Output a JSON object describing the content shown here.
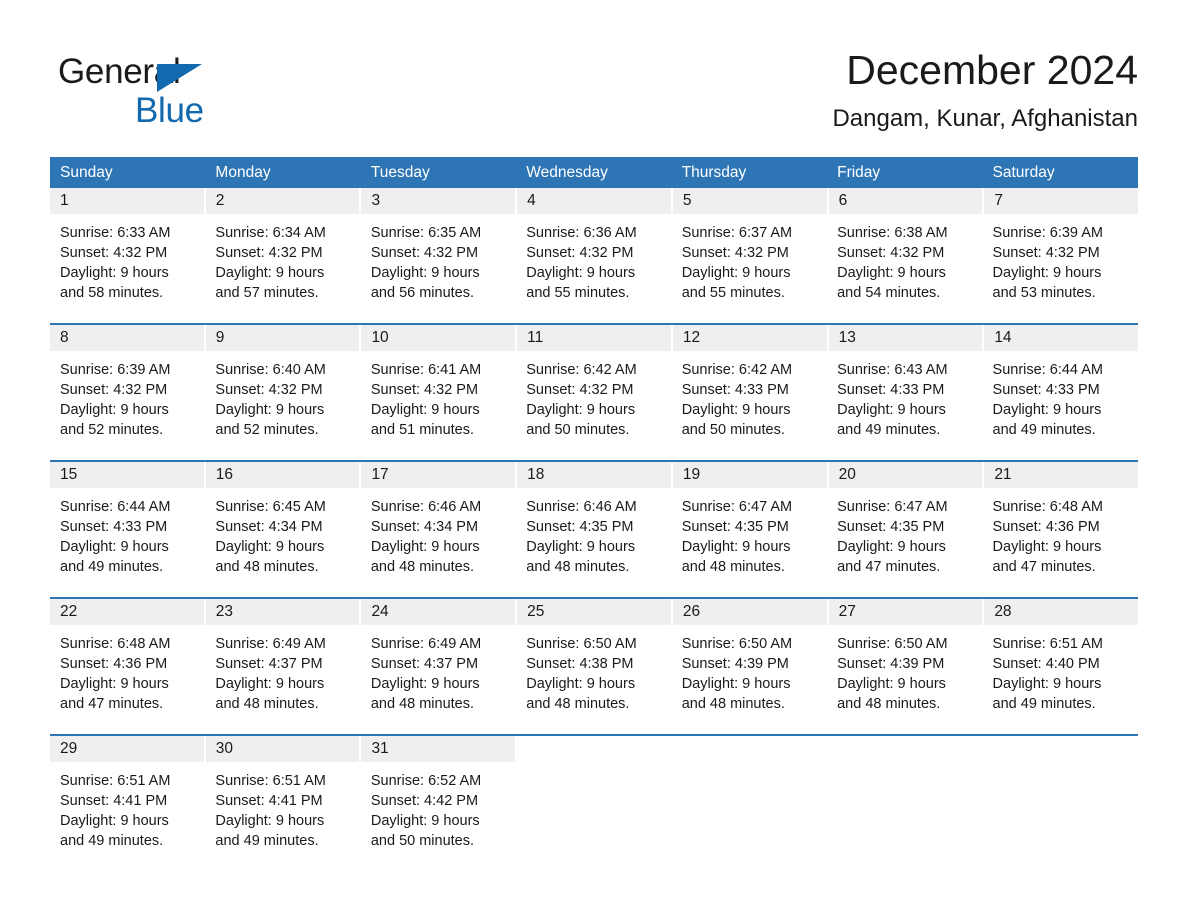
{
  "brand": {
    "name_part1": "General",
    "name_part2": "Blue",
    "accent_color": "#1369ad"
  },
  "header": {
    "title": "December 2024",
    "subtitle": "Dangam, Kunar, Afghanistan"
  },
  "theme": {
    "header_blue": "#2e75b6",
    "daynum_gray": "#efefef",
    "text_color": "#1a1a1a"
  },
  "weekdays": [
    "Sunday",
    "Monday",
    "Tuesday",
    "Wednesday",
    "Thursday",
    "Friday",
    "Saturday"
  ],
  "weeks": [
    {
      "days": [
        {
          "num": "1",
          "sunrise": "Sunrise: 6:33 AM",
          "sunset": "Sunset: 4:32 PM",
          "daylight_line1": "Daylight: 9 hours",
          "daylight_line2": "and 58 minutes."
        },
        {
          "num": "2",
          "sunrise": "Sunrise: 6:34 AM",
          "sunset": "Sunset: 4:32 PM",
          "daylight_line1": "Daylight: 9 hours",
          "daylight_line2": "and 57 minutes."
        },
        {
          "num": "3",
          "sunrise": "Sunrise: 6:35 AM",
          "sunset": "Sunset: 4:32 PM",
          "daylight_line1": "Daylight: 9 hours",
          "daylight_line2": "and 56 minutes."
        },
        {
          "num": "4",
          "sunrise": "Sunrise: 6:36 AM",
          "sunset": "Sunset: 4:32 PM",
          "daylight_line1": "Daylight: 9 hours",
          "daylight_line2": "and 55 minutes."
        },
        {
          "num": "5",
          "sunrise": "Sunrise: 6:37 AM",
          "sunset": "Sunset: 4:32 PM",
          "daylight_line1": "Daylight: 9 hours",
          "daylight_line2": "and 55 minutes."
        },
        {
          "num": "6",
          "sunrise": "Sunrise: 6:38 AM",
          "sunset": "Sunset: 4:32 PM",
          "daylight_line1": "Daylight: 9 hours",
          "daylight_line2": "and 54 minutes."
        },
        {
          "num": "7",
          "sunrise": "Sunrise: 6:39 AM",
          "sunset": "Sunset: 4:32 PM",
          "daylight_line1": "Daylight: 9 hours",
          "daylight_line2": "and 53 minutes."
        }
      ]
    },
    {
      "days": [
        {
          "num": "8",
          "sunrise": "Sunrise: 6:39 AM",
          "sunset": "Sunset: 4:32 PM",
          "daylight_line1": "Daylight: 9 hours",
          "daylight_line2": "and 52 minutes."
        },
        {
          "num": "9",
          "sunrise": "Sunrise: 6:40 AM",
          "sunset": "Sunset: 4:32 PM",
          "daylight_line1": "Daylight: 9 hours",
          "daylight_line2": "and 52 minutes."
        },
        {
          "num": "10",
          "sunrise": "Sunrise: 6:41 AM",
          "sunset": "Sunset: 4:32 PM",
          "daylight_line1": "Daylight: 9 hours",
          "daylight_line2": "and 51 minutes."
        },
        {
          "num": "11",
          "sunrise": "Sunrise: 6:42 AM",
          "sunset": "Sunset: 4:32 PM",
          "daylight_line1": "Daylight: 9 hours",
          "daylight_line2": "and 50 minutes."
        },
        {
          "num": "12",
          "sunrise": "Sunrise: 6:42 AM",
          "sunset": "Sunset: 4:33 PM",
          "daylight_line1": "Daylight: 9 hours",
          "daylight_line2": "and 50 minutes."
        },
        {
          "num": "13",
          "sunrise": "Sunrise: 6:43 AM",
          "sunset": "Sunset: 4:33 PM",
          "daylight_line1": "Daylight: 9 hours",
          "daylight_line2": "and 49 minutes."
        },
        {
          "num": "14",
          "sunrise": "Sunrise: 6:44 AM",
          "sunset": "Sunset: 4:33 PM",
          "daylight_line1": "Daylight: 9 hours",
          "daylight_line2": "and 49 minutes."
        }
      ]
    },
    {
      "days": [
        {
          "num": "15",
          "sunrise": "Sunrise: 6:44 AM",
          "sunset": "Sunset: 4:33 PM",
          "daylight_line1": "Daylight: 9 hours",
          "daylight_line2": "and 49 minutes."
        },
        {
          "num": "16",
          "sunrise": "Sunrise: 6:45 AM",
          "sunset": "Sunset: 4:34 PM",
          "daylight_line1": "Daylight: 9 hours",
          "daylight_line2": "and 48 minutes."
        },
        {
          "num": "17",
          "sunrise": "Sunrise: 6:46 AM",
          "sunset": "Sunset: 4:34 PM",
          "daylight_line1": "Daylight: 9 hours",
          "daylight_line2": "and 48 minutes."
        },
        {
          "num": "18",
          "sunrise": "Sunrise: 6:46 AM",
          "sunset": "Sunset: 4:35 PM",
          "daylight_line1": "Daylight: 9 hours",
          "daylight_line2": "and 48 minutes."
        },
        {
          "num": "19",
          "sunrise": "Sunrise: 6:47 AM",
          "sunset": "Sunset: 4:35 PM",
          "daylight_line1": "Daylight: 9 hours",
          "daylight_line2": "and 48 minutes."
        },
        {
          "num": "20",
          "sunrise": "Sunrise: 6:47 AM",
          "sunset": "Sunset: 4:35 PM",
          "daylight_line1": "Daylight: 9 hours",
          "daylight_line2": "and 47 minutes."
        },
        {
          "num": "21",
          "sunrise": "Sunrise: 6:48 AM",
          "sunset": "Sunset: 4:36 PM",
          "daylight_line1": "Daylight: 9 hours",
          "daylight_line2": "and 47 minutes."
        }
      ]
    },
    {
      "days": [
        {
          "num": "22",
          "sunrise": "Sunrise: 6:48 AM",
          "sunset": "Sunset: 4:36 PM",
          "daylight_line1": "Daylight: 9 hours",
          "daylight_line2": "and 47 minutes."
        },
        {
          "num": "23",
          "sunrise": "Sunrise: 6:49 AM",
          "sunset": "Sunset: 4:37 PM",
          "daylight_line1": "Daylight: 9 hours",
          "daylight_line2": "and 48 minutes."
        },
        {
          "num": "24",
          "sunrise": "Sunrise: 6:49 AM",
          "sunset": "Sunset: 4:37 PM",
          "daylight_line1": "Daylight: 9 hours",
          "daylight_line2": "and 48 minutes."
        },
        {
          "num": "25",
          "sunrise": "Sunrise: 6:50 AM",
          "sunset": "Sunset: 4:38 PM",
          "daylight_line1": "Daylight: 9 hours",
          "daylight_line2": "and 48 minutes."
        },
        {
          "num": "26",
          "sunrise": "Sunrise: 6:50 AM",
          "sunset": "Sunset: 4:39 PM",
          "daylight_line1": "Daylight: 9 hours",
          "daylight_line2": "and 48 minutes."
        },
        {
          "num": "27",
          "sunrise": "Sunrise: 6:50 AM",
          "sunset": "Sunset: 4:39 PM",
          "daylight_line1": "Daylight: 9 hours",
          "daylight_line2": "and 48 minutes."
        },
        {
          "num": "28",
          "sunrise": "Sunrise: 6:51 AM",
          "sunset": "Sunset: 4:40 PM",
          "daylight_line1": "Daylight: 9 hours",
          "daylight_line2": "and 49 minutes."
        }
      ]
    },
    {
      "days": [
        {
          "num": "29",
          "sunrise": "Sunrise: 6:51 AM",
          "sunset": "Sunset: 4:41 PM",
          "daylight_line1": "Daylight: 9 hours",
          "daylight_line2": "and 49 minutes."
        },
        {
          "num": "30",
          "sunrise": "Sunrise: 6:51 AM",
          "sunset": "Sunset: 4:41 PM",
          "daylight_line1": "Daylight: 9 hours",
          "daylight_line2": "and 49 minutes."
        },
        {
          "num": "31",
          "sunrise": "Sunrise: 6:52 AM",
          "sunset": "Sunset: 4:42 PM",
          "daylight_line1": "Daylight: 9 hours",
          "daylight_line2": "and 50 minutes."
        },
        {
          "num": "",
          "sunrise": "",
          "sunset": "",
          "daylight_line1": "",
          "daylight_line2": ""
        },
        {
          "num": "",
          "sunrise": "",
          "sunset": "",
          "daylight_line1": "",
          "daylight_line2": ""
        },
        {
          "num": "",
          "sunrise": "",
          "sunset": "",
          "daylight_line1": "",
          "daylight_line2": ""
        },
        {
          "num": "",
          "sunrise": "",
          "sunset": "",
          "daylight_line1": "",
          "daylight_line2": ""
        }
      ]
    }
  ]
}
